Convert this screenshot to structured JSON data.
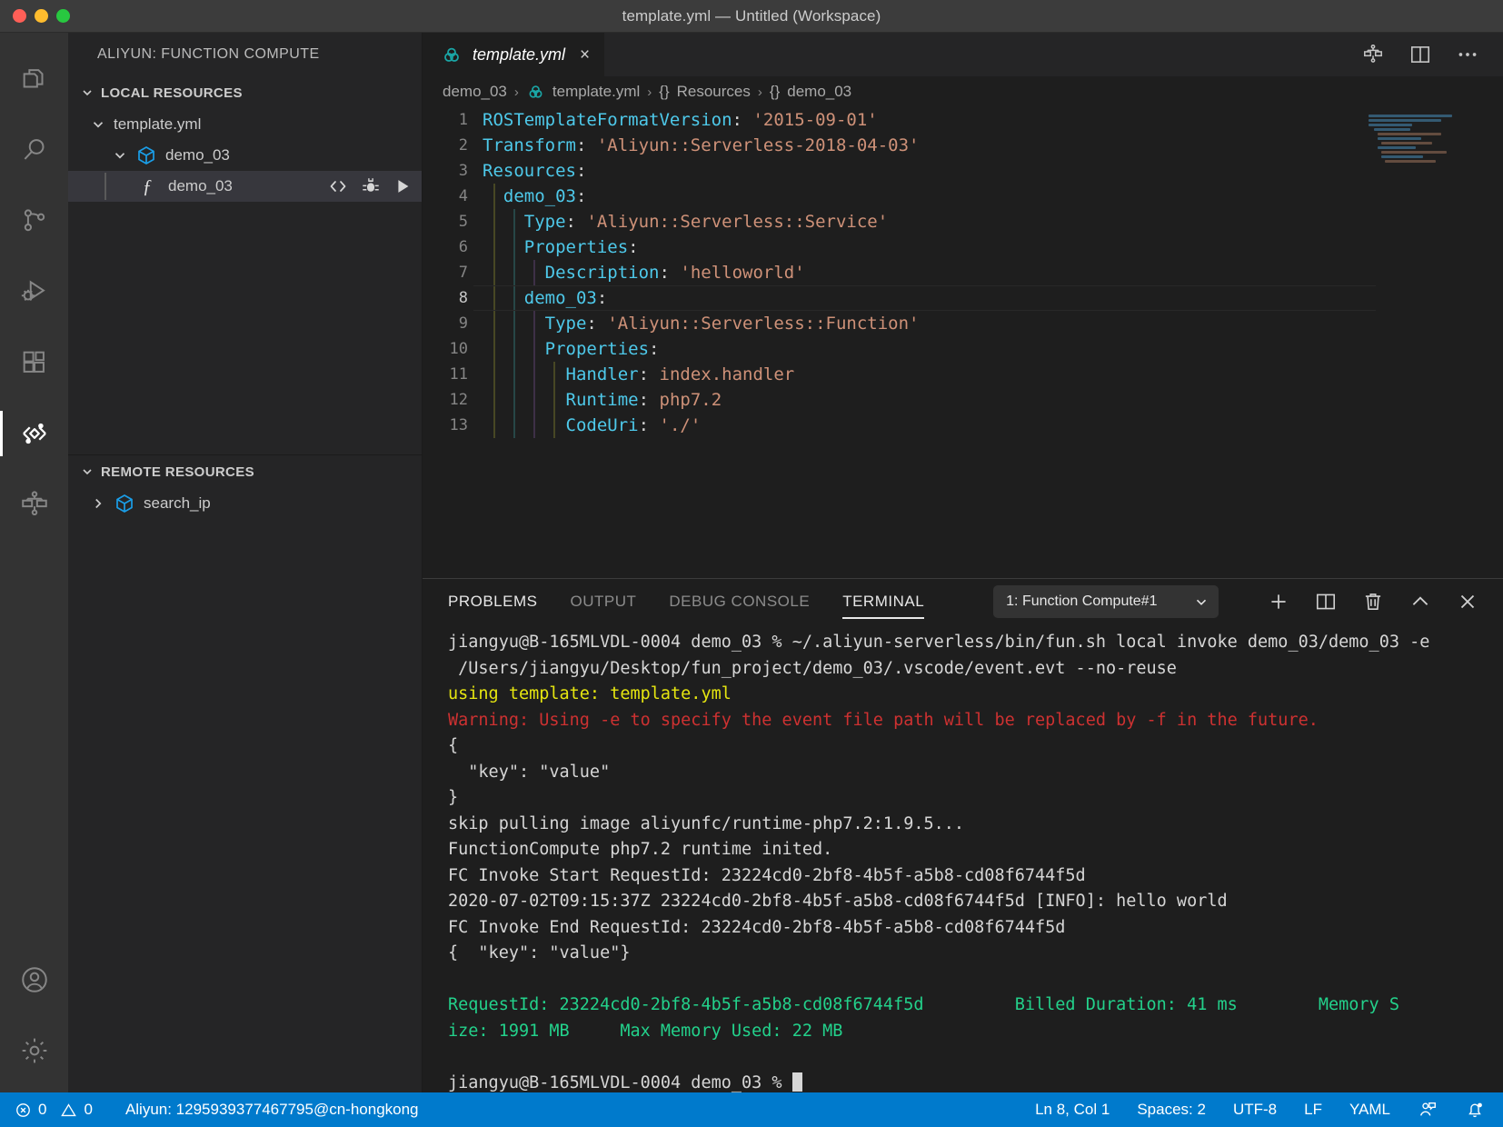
{
  "window": {
    "title": "template.yml — Untitled (Workspace)",
    "traffic_lights": [
      "close-red",
      "minimize-yellow",
      "zoom-green"
    ]
  },
  "activitybar": {
    "items": [
      {
        "name": "explorer",
        "icon": "files-icon",
        "active": false
      },
      {
        "name": "search",
        "icon": "search-icon",
        "active": false
      },
      {
        "name": "source-control",
        "icon": "source-control-icon",
        "active": false
      },
      {
        "name": "run-and-debug",
        "icon": "run-debug-icon",
        "active": false
      },
      {
        "name": "extensions",
        "icon": "extensions-icon",
        "active": false
      },
      {
        "name": "aliyun-function-compute",
        "icon": "aliyun-fc-icon",
        "active": true
      },
      {
        "name": "aliyun-serverless-workflow",
        "icon": "workflow-icon",
        "active": false
      }
    ],
    "bottom": [
      {
        "name": "accounts",
        "icon": "account-icon"
      },
      {
        "name": "manage",
        "icon": "gear-icon"
      }
    ]
  },
  "sidebar": {
    "title": "ALIYUN: FUNCTION COMPUTE",
    "local": {
      "header": "LOCAL RESOURCES",
      "expanded": true,
      "items": [
        {
          "label": "template.yml",
          "depth": 1,
          "expanded": true,
          "icon": "chevron-down-icon",
          "selected": false
        },
        {
          "label": "demo_03",
          "depth": 2,
          "expanded": true,
          "icon": "service-cube-icon",
          "selected": false
        },
        {
          "label": "demo_03",
          "depth": 3,
          "expanded": null,
          "icon": "function-f-icon",
          "selected": true,
          "actions": [
            "code-icon",
            "debug-bug-icon",
            "run-play-icon"
          ]
        }
      ]
    },
    "remote": {
      "header": "REMOTE RESOURCES",
      "expanded": true,
      "items": [
        {
          "label": "search_ip",
          "depth": 1,
          "expanded": false,
          "icon": "service-cube-icon",
          "selected": false
        }
      ]
    }
  },
  "editor": {
    "tab": {
      "label": "template.yml",
      "icon": "aliyun-fc-file-icon",
      "close": "×",
      "active": true
    },
    "tab_actions": [
      "workflow-graph-icon",
      "split-editor-icon",
      "more-actions-icon"
    ],
    "breadcrumbs": [
      {
        "text": "demo_03",
        "icon": null
      },
      {
        "text": "template.yml",
        "icon": "aliyun-fc-file-icon"
      },
      {
        "text": "Resources",
        "icon": "braces-icon"
      },
      {
        "text": "demo_03",
        "icon": "braces-icon"
      }
    ],
    "breadcrumb_separator": "›",
    "lines": [
      {
        "n": 1,
        "indent": 0,
        "key": "ROSTemplateFormatVersion",
        "value": "'2015-09-01'",
        "vtype": "string"
      },
      {
        "n": 2,
        "indent": 0,
        "key": "Transform",
        "value": "'Aliyun::Serverless-2018-04-03'",
        "vtype": "string"
      },
      {
        "n": 3,
        "indent": 0,
        "key": "Resources",
        "value": "",
        "vtype": "none"
      },
      {
        "n": 4,
        "indent": 1,
        "key": "demo_03",
        "value": "",
        "vtype": "none"
      },
      {
        "n": 5,
        "indent": 2,
        "key": "Type",
        "value": "'Aliyun::Serverless::Service'",
        "vtype": "string"
      },
      {
        "n": 6,
        "indent": 2,
        "key": "Properties",
        "value": "",
        "vtype": "none"
      },
      {
        "n": 7,
        "indent": 3,
        "key": "Description",
        "value": "'helloworld'",
        "vtype": "string"
      },
      {
        "n": 8,
        "indent": 2,
        "key": "demo_03",
        "value": "",
        "vtype": "none",
        "current": true
      },
      {
        "n": 9,
        "indent": 3,
        "key": "Type",
        "value": "'Aliyun::Serverless::Function'",
        "vtype": "string"
      },
      {
        "n": 10,
        "indent": 3,
        "key": "Properties",
        "value": "",
        "vtype": "none"
      },
      {
        "n": 11,
        "indent": 4,
        "key": "Handler",
        "value": "index.handler",
        "vtype": "plain"
      },
      {
        "n": 12,
        "indent": 4,
        "key": "Runtime",
        "value": "php7.2",
        "vtype": "plain"
      },
      {
        "n": 13,
        "indent": 4,
        "key": "CodeUri",
        "value": "'./'",
        "vtype": "string"
      }
    ],
    "language": "YAML"
  },
  "panel": {
    "tabs": [
      {
        "label": "PROBLEMS",
        "active": false,
        "bright": true
      },
      {
        "label": "OUTPUT",
        "active": false,
        "bright": false
      },
      {
        "label": "DEBUG CONSOLE",
        "active": false,
        "bright": false
      },
      {
        "label": "TERMINAL",
        "active": true,
        "bright": true
      }
    ],
    "terminal_select": {
      "value": "1: Function Compute#1",
      "chevron": "⌄"
    },
    "actions": [
      "new-terminal-icon",
      "split-terminal-icon",
      "kill-terminal-icon",
      "maximize-panel-icon",
      "close-panel-icon"
    ],
    "terminal_lines": [
      {
        "text": "jiangyu@B-165MLVDL-0004 demo_03 % ~/.aliyun-serverless/bin/fun.sh local invoke demo_03/demo_03 -e",
        "color": "default"
      },
      {
        "text": " /Users/jiangyu/Desktop/fun_project/demo_03/.vscode/event.evt --no-reuse",
        "color": "default"
      },
      {
        "text": "using template: template.yml",
        "color": "yellow"
      },
      {
        "text": "Warning: Using -e to specify the event file path will be replaced by -f in the future.",
        "color": "red"
      },
      {
        "text": "{",
        "color": "default"
      },
      {
        "text": "  \"key\": \"value\"",
        "color": "default"
      },
      {
        "text": "}",
        "color": "default"
      },
      {
        "text": "skip pulling image aliyunfc/runtime-php7.2:1.9.5...",
        "color": "default"
      },
      {
        "text": "FunctionCompute php7.2 runtime inited.",
        "color": "default"
      },
      {
        "text": "FC Invoke Start RequestId: 23224cd0-2bf8-4b5f-a5b8-cd08f6744f5d",
        "color": "default"
      },
      {
        "text": "2020-07-02T09:15:37Z 23224cd0-2bf8-4b5f-a5b8-cd08f6744f5d [INFO]: hello world",
        "color": "default"
      },
      {
        "text": "FC Invoke End RequestId: 23224cd0-2bf8-4b5f-a5b8-cd08f6744f5d",
        "color": "default"
      },
      {
        "text": "{  \"key\": \"value\"}",
        "color": "default"
      },
      {
        "text": "",
        "color": "default"
      },
      {
        "text": "RequestId: 23224cd0-2bf8-4b5f-a5b8-cd08f6744f5d         Billed Duration: 41 ms        Memory S",
        "color": "green"
      },
      {
        "text": "ize: 1991 MB     Max Memory Used: 22 MB",
        "color": "green"
      },
      {
        "text": "",
        "color": "default"
      },
      {
        "text": "jiangyu@B-165MLVDL-0004 demo_03 % ",
        "color": "default",
        "cursor": true
      }
    ]
  },
  "statusbar": {
    "errors": "0",
    "warnings": "0",
    "aliyun_account": "Aliyun: 1295939377467795@cn-hongkong",
    "position": "Ln 8, Col 1",
    "indentation": "Spaces: 2",
    "encoding": "UTF-8",
    "eol": "LF",
    "language": "YAML",
    "icons": [
      "feedback-icon",
      "bell-icon"
    ],
    "background": "#007acc"
  },
  "colors": {
    "accent": "#007acc",
    "titlebar": "#3c3c3c",
    "activitybar": "#333333",
    "sidebar": "#252526",
    "editor": "#1e1e1e",
    "selected_row": "#37373d",
    "key_blue": "#4ec9ea",
    "string_orange": "#ce9178",
    "terminal_green": "#23d18b",
    "terminal_yellow": "#e5e510",
    "terminal_red": "#cd3131",
    "cube_blue": "#1a9ee8"
  }
}
